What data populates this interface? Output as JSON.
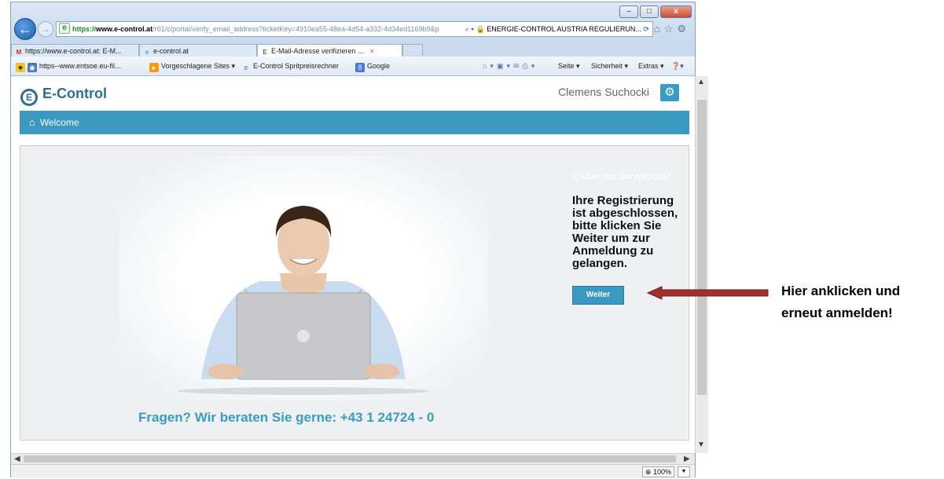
{
  "browser": {
    "url_https": "https://",
    "url_host": "www.e-control.at",
    "url_path": "/r01/c/portal/verify_email_address?ticketKey=4910ea55-48ea-4d54-a332-4d34ed1169b9&p",
    "cert_label": "ENERGIE-CONTROL AUSTRIA REGULIERUN...",
    "tabs": [
      {
        "label": "https://www.e-control.at: E-M..."
      },
      {
        "label": "e-control.at"
      },
      {
        "label": "E-Mail-Adresse verifizieren ..."
      }
    ],
    "favorites": [
      {
        "label": "https--www.entsoe.eu-fil..."
      },
      {
        "label": "Vorgeschlagene Sites ▾"
      },
      {
        "label": "E-Control Spritpreisrechner"
      },
      {
        "label": "Google"
      }
    ],
    "command_bar": [
      {
        "label": "Seite ▾"
      },
      {
        "label": "Sicherheit ▾"
      },
      {
        "label": "Extras ▾"
      }
    ],
    "zoom": "100%"
  },
  "page": {
    "logo": "E-Control",
    "user_name": "Clemens Suchocki",
    "nav_welcome": "Welcome",
    "side_link": "Über das Serviceportal",
    "registration_text": "Ihre Registrierung ist abgeschlossen, bitte klicken Sie Weiter um zur Anmeldung zu gelangen.",
    "weiter_label": "Weiter",
    "hotline": "Fragen? Wir beraten Sie gerne: +43 1 24724 - 0"
  },
  "annotation": {
    "line1": "Hier anklicken und",
    "line2": "erneut anmelden!",
    "arrow_color": "#a32e2e"
  }
}
